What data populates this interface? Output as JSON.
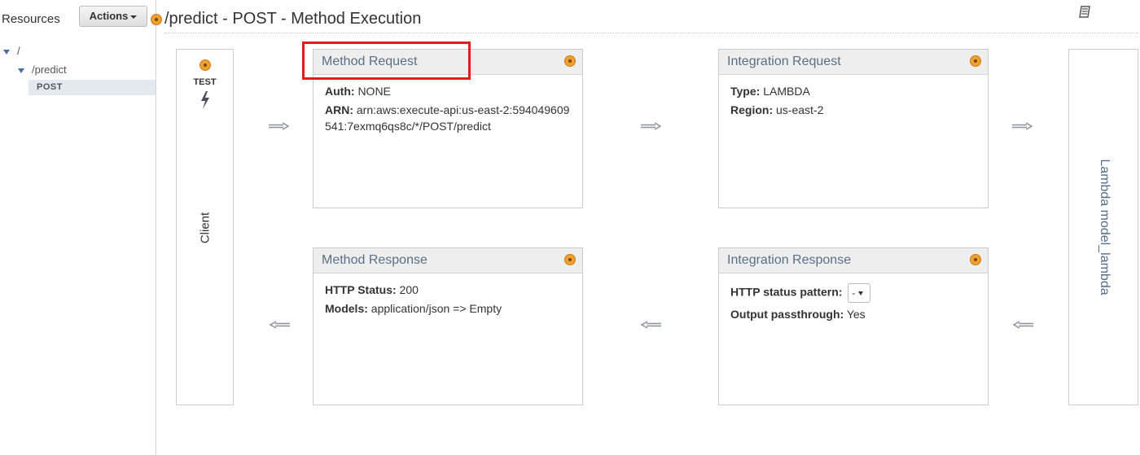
{
  "sidebar": {
    "title": "Resources",
    "actions_label": "Actions",
    "tree": {
      "root": "/",
      "predict": "/predict",
      "post": "POST"
    }
  },
  "header": {
    "title": "/predict - POST - Method Execution"
  },
  "client": {
    "test_label": "TEST",
    "label": "Client"
  },
  "lambda": {
    "label": "Lambda model_lambda"
  },
  "method_request": {
    "title": "Method Request",
    "auth_label": "Auth:",
    "auth_value": "NONE",
    "arn_label": "ARN:",
    "arn_value": "arn:aws:execute-api:us-east-2:594049609541:7exmq6qs8c/*/POST/predict"
  },
  "integration_request": {
    "title": "Integration Request",
    "type_label": "Type:",
    "type_value": "LAMBDA",
    "region_label": "Region:",
    "region_value": "us-east-2"
  },
  "method_response": {
    "title": "Method Response",
    "status_label": "HTTP Status:",
    "status_value": "200",
    "models_label": "Models:",
    "models_value": "application/json => Empty"
  },
  "integration_response": {
    "title": "Integration Response",
    "pattern_label": "HTTP status pattern:",
    "pattern_value": "-",
    "passthrough_label": "Output passthrough:",
    "passthrough_value": "Yes"
  },
  "icons": {
    "dot": "orange-dot-icon",
    "book": "book-icon",
    "bolt": "lightning-icon",
    "arrow_right": "arrow-right-icon",
    "arrow_left": "arrow-left-icon"
  },
  "colors": {
    "accent_dot": "#f0a030",
    "highlight": "#e21b1b",
    "title_text": "#5b6f84",
    "lambda_text": "#546e8a"
  }
}
